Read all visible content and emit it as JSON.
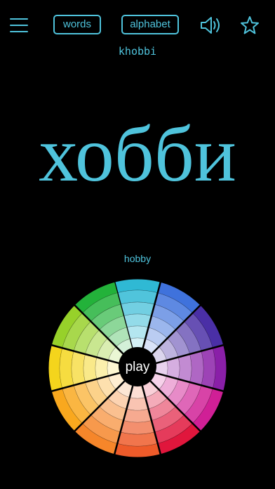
{
  "header": {
    "menu_icon": "hamburger-menu-icon",
    "words_label": "words",
    "alphabet_label": "alphabet",
    "speaker_icon": "speaker-icon",
    "favorite_icon": "star-icon"
  },
  "word": {
    "transliteration": "khobbi",
    "cyrillic": "хобби",
    "translation": "hobby"
  },
  "wheel": {
    "play_label": "play",
    "accent": "#4fc3dc",
    "segment_colors": [
      "#2fb9d4",
      "#3f72dc",
      "#4a2fa6",
      "#8a1fa8",
      "#d01f96",
      "#e0163c",
      "#ee5b2a",
      "#f6862a",
      "#f9a81e",
      "#f4d51c",
      "#97d12a",
      "#23b23a"
    ]
  }
}
